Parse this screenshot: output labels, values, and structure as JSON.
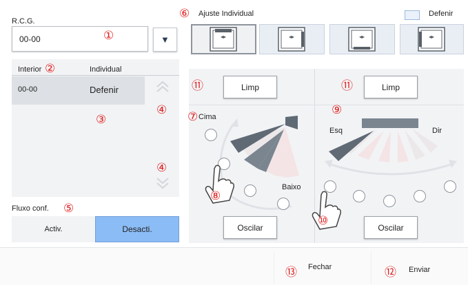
{
  "rcg": {
    "label": "R.C.G.",
    "value": "00-00"
  },
  "ajuste": {
    "title": "Ajuste Individual",
    "defenir_label": "Defenir",
    "louvers": [
      {
        "name": "louver-1",
        "selected": true
      },
      {
        "name": "louver-2",
        "selected": false
      },
      {
        "name": "louver-3",
        "selected": false
      },
      {
        "name": "louver-4",
        "selected": false
      }
    ]
  },
  "list": {
    "col_interior": "Interior",
    "col_individual": "Individual",
    "rows": [
      {
        "interior": "00-00",
        "individual": "Defenir"
      }
    ]
  },
  "fluxo": {
    "label": "Fluxo conf.",
    "activ": "Activ.",
    "desacti": "Desacti."
  },
  "vertical": {
    "limp": "Limp",
    "cima": "Cima",
    "baixo": "Baixo",
    "oscilar": "Oscilar"
  },
  "horizontal": {
    "limp": "Limp",
    "esq": "Esq",
    "dir": "Dir",
    "oscilar": "Oscilar"
  },
  "footer": {
    "fechar": "Fechar",
    "enviar": "Enviar"
  },
  "callouts": [
    "①",
    "②",
    "③",
    "④",
    "④",
    "⑤",
    "⑥",
    "⑦",
    "⑧",
    "⑨",
    "⑩",
    "⑪",
    "⑪",
    "⑫",
    "⑬"
  ],
  "colors": {
    "accent": "#8cbcf5",
    "dark_gray": "#6b7480",
    "panel": "#f2f3f5"
  }
}
